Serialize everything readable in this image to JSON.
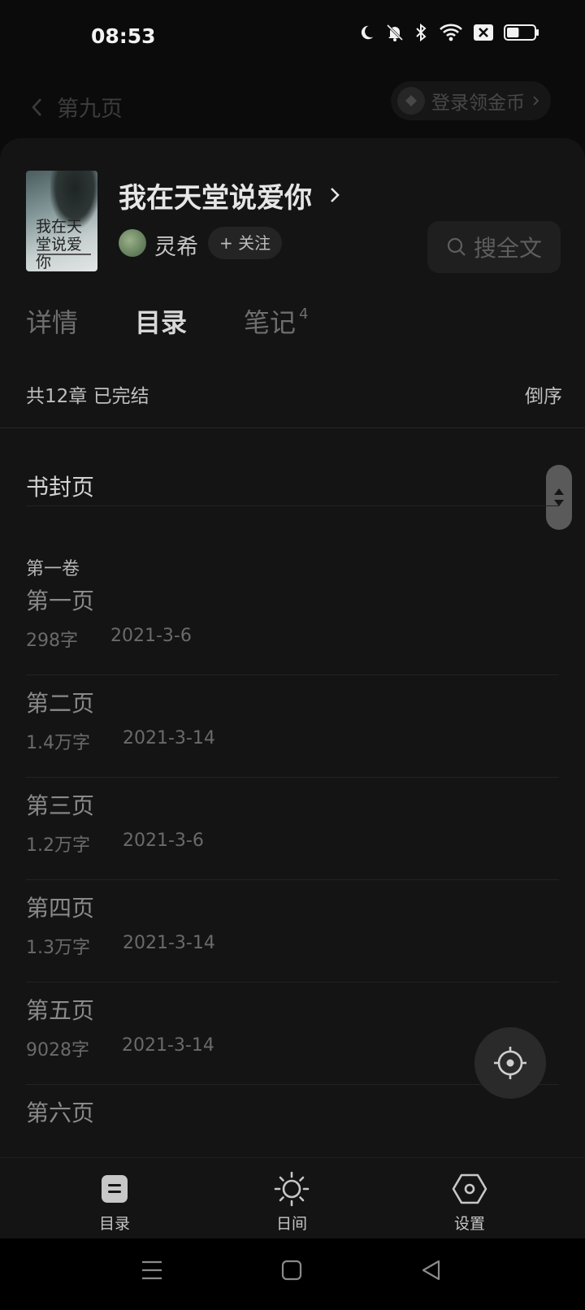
{
  "status_bar": {
    "time": "08:53",
    "icons": [
      "moon-icon",
      "bell-muted-icon",
      "bluetooth-icon",
      "wifi-icon",
      "sim-off-icon",
      "battery-icon"
    ],
    "battery_level": 0.45
  },
  "reader": {
    "back_title": "第九页",
    "login_coins_label": "登录领金币"
  },
  "book": {
    "title": "我在天堂说爱你",
    "cover_text": "我在天堂说爱你",
    "author": "灵希",
    "follow_label": "+ 关注",
    "search_label": "搜全文"
  },
  "tabs": [
    {
      "label": "详情",
      "badge": ""
    },
    {
      "label": "目录",
      "badge": ""
    },
    {
      "label": "笔记",
      "badge": "4"
    }
  ],
  "active_tab": "目录",
  "toc": {
    "summary": "共12章 已完结",
    "reverse_label": "倒序",
    "cover_page_label": "书封页",
    "volume_label": "第一卷",
    "chapters": [
      {
        "title": "第一页",
        "words": "298字",
        "date": "2021-3-6"
      },
      {
        "title": "第二页",
        "words": "1.4万字",
        "date": "2021-3-14"
      },
      {
        "title": "第三页",
        "words": "1.2万字",
        "date": "2021-3-6"
      },
      {
        "title": "第四页",
        "words": "1.3万字",
        "date": "2021-3-14"
      },
      {
        "title": "第五页",
        "words": "9028字",
        "date": "2021-3-14"
      },
      {
        "title": "第六页",
        "words": "",
        "date": ""
      }
    ]
  },
  "toolbar": {
    "toc_label": "目录",
    "day_label": "日间",
    "settings_label": "设置"
  },
  "colors": {
    "background": "#0b0b0b",
    "sheet": "#141414",
    "text_primary": "#e6e6e6",
    "text_muted": "#8a8a8a"
  }
}
